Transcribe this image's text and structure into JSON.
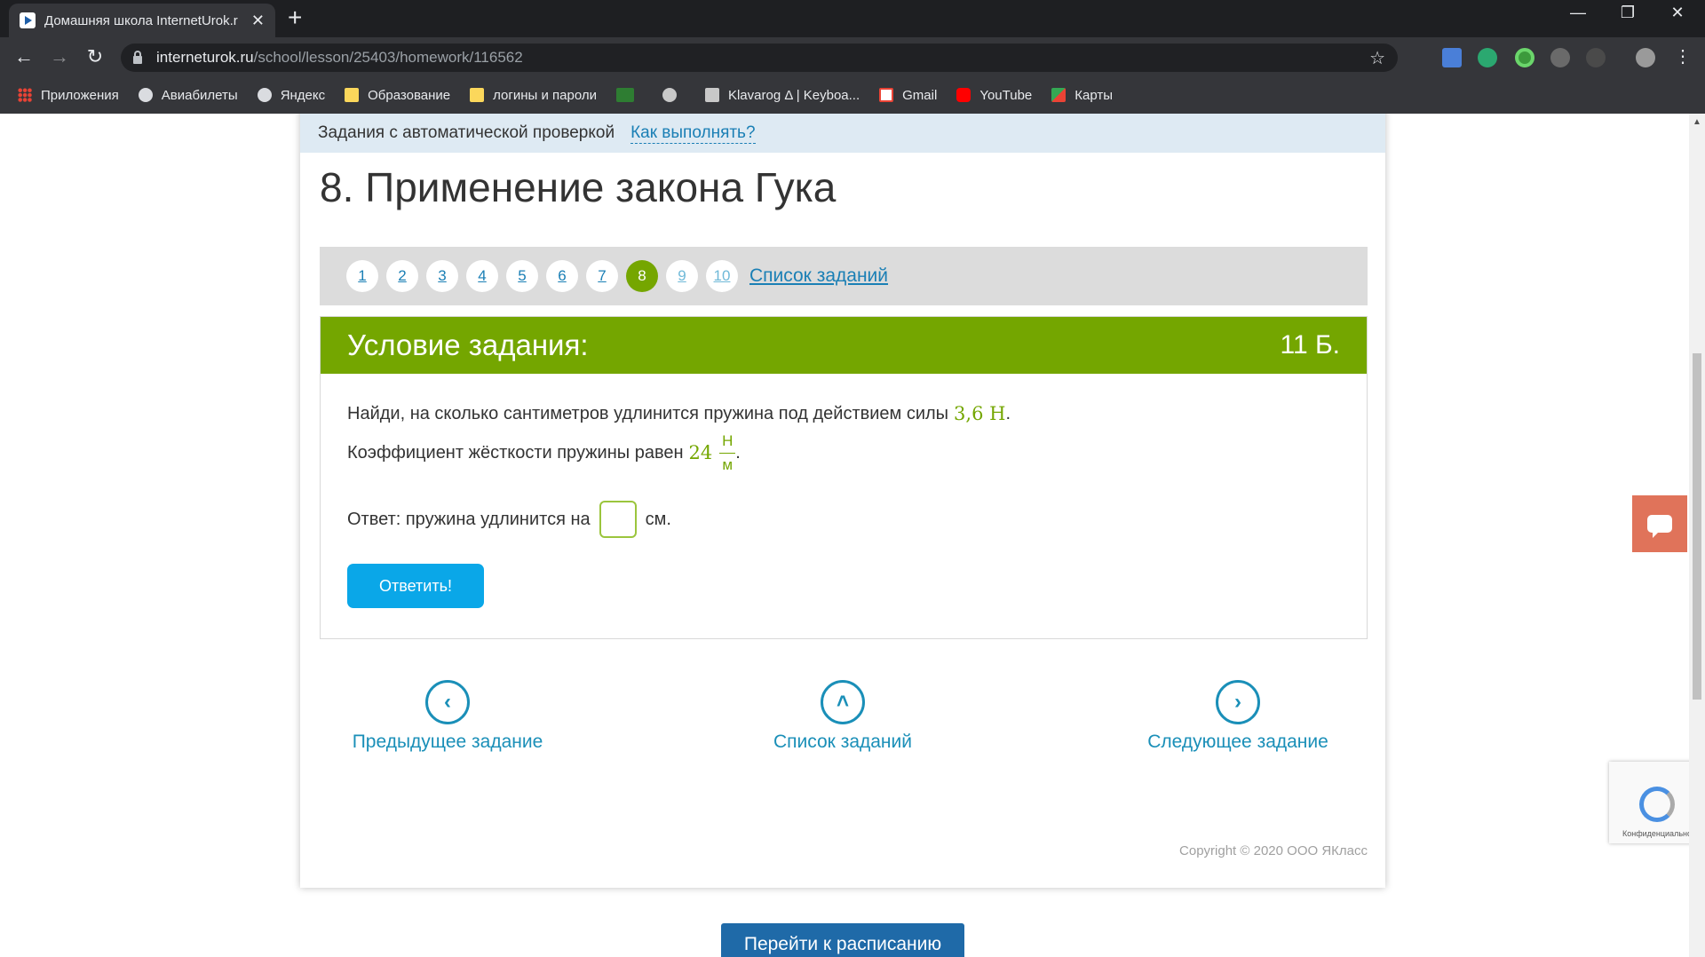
{
  "browser": {
    "tab_title": "Домашняя школа InternetUrok.r",
    "url_host": "interneturok.ru",
    "url_path": "/school/lesson/25403/homework/116562",
    "window_controls": [
      "—",
      "❐",
      "✕"
    ]
  },
  "bookmarks": [
    {
      "label": "Приложения",
      "icon": "apps-icon"
    },
    {
      "label": "Авиабилеты",
      "icon": "globe-icon"
    },
    {
      "label": "Яндекс",
      "icon": "globe-icon"
    },
    {
      "label": "Образование",
      "icon": "folder-icon"
    },
    {
      "label": "логины и пароли",
      "icon": "folder-icon"
    },
    {
      "label": "",
      "icon": "egov-icon"
    },
    {
      "label": "",
      "icon": "gear-icon"
    },
    {
      "label": "Klavarog Δ | Keyboa...",
      "icon": "page-icon"
    },
    {
      "label": "Gmail",
      "icon": "gmail-icon"
    },
    {
      "label": "YouTube",
      "icon": "youtube-icon"
    },
    {
      "label": "Карты",
      "icon": "maps-icon"
    }
  ],
  "page": {
    "strip_text": "Задания с автоматической проверкой",
    "strip_link": "Как выполнять?",
    "title": "8. Применение закона Гука",
    "pager": {
      "pages": [
        "1",
        "2",
        "3",
        "4",
        "5",
        "6",
        "7",
        "8",
        "9",
        "10"
      ],
      "active": "8",
      "list_link": "Список заданий"
    },
    "task": {
      "heading": "Условие задания:",
      "points": "11 Б.",
      "line1_text": "Найди, на сколько сантиметров удлинится пружина под действием силы",
      "force": "3,6 Н",
      "line2_text": "Коэффициент жёсткости пружины равен",
      "k_value": "24",
      "k_num": "Н",
      "k_den": "м",
      "answer_prefix": "Ответ: пружина удлинится на",
      "answer_value": "",
      "answer_unit": "см.",
      "submit_label": "Ответить!"
    },
    "nav": {
      "prev": "Предыдущее задание",
      "list": "Список заданий",
      "next": "Следующее задание"
    },
    "copyright": "Copyright © 2020 ООО ЯКласс",
    "schedule_button": "Перейти к расписанию",
    "recaptcha_text": "Конфиденциально"
  },
  "colors": {
    "accent_green": "#74a600",
    "link_blue": "#1a7fb5",
    "button_blue": "#0aa7e8",
    "chat_button": "#e0735a"
  }
}
